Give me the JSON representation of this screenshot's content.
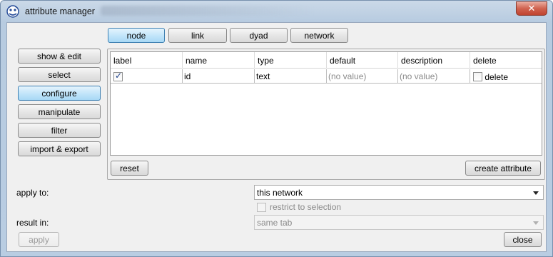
{
  "window": {
    "title": "attribute manager"
  },
  "top_tabs": [
    {
      "label": "node",
      "active": true
    },
    {
      "label": "link",
      "active": false
    },
    {
      "label": "dyad",
      "active": false
    },
    {
      "label": "network",
      "active": false
    }
  ],
  "side_menu": [
    {
      "label": "show & edit",
      "active": false
    },
    {
      "label": "select",
      "active": false
    },
    {
      "label": "configure",
      "active": true
    },
    {
      "label": "manipulate",
      "active": false
    },
    {
      "label": "filter",
      "active": false
    },
    {
      "label": "import & export",
      "active": false
    }
  ],
  "table": {
    "columns": [
      "label",
      "name",
      "type",
      "default",
      "description",
      "delete"
    ],
    "rows": [
      {
        "label_checked": true,
        "name": "id",
        "type": "text",
        "default": "(no value)",
        "description": "(no value)",
        "delete_label": "delete",
        "delete_checked": false
      }
    ]
  },
  "panel_buttons": {
    "reset": "reset",
    "create": "create attribute"
  },
  "apply_to": {
    "label": "apply to:",
    "value": "this network"
  },
  "restrict": {
    "label": "restrict to selection",
    "checked": false
  },
  "result_in": {
    "label": "result in:",
    "value": "same tab"
  },
  "footer": {
    "apply": "apply",
    "close": "close"
  },
  "colors": {
    "active_button": "#c4e6fa",
    "window_frame": "#b9cde2",
    "close_button": "#d0624f"
  }
}
